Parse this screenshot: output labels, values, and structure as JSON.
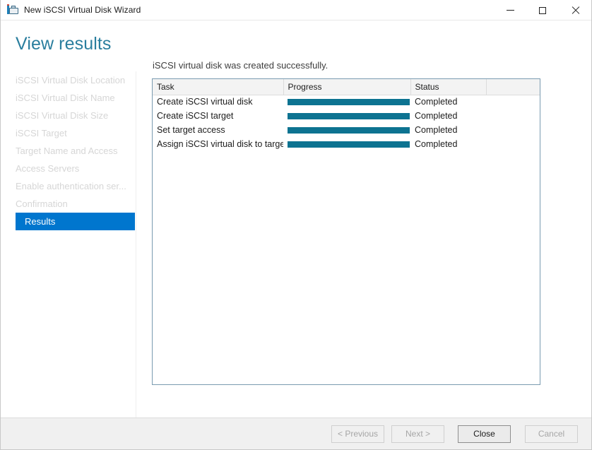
{
  "window": {
    "title": "New iSCSI Virtual Disk Wizard",
    "icon": "iscsi-disk-icon",
    "controls": {
      "minimize": "minimize-icon",
      "maximize": "maximize-icon",
      "close": "close-icon"
    }
  },
  "header": {
    "title": "View results",
    "title_color": "#2a7e9e"
  },
  "sidebar": {
    "items": [
      {
        "label": "iSCSI Virtual Disk Location",
        "active": false
      },
      {
        "label": "iSCSI Virtual Disk Name",
        "active": false
      },
      {
        "label": "iSCSI Virtual Disk Size",
        "active": false
      },
      {
        "label": "iSCSI Target",
        "active": false
      },
      {
        "label": "Target Name and Access",
        "active": false
      },
      {
        "label": "Access Servers",
        "active": false
      },
      {
        "label": "Enable authentication ser...",
        "active": false
      },
      {
        "label": "Confirmation",
        "active": false
      },
      {
        "label": "Results",
        "active": true
      }
    ],
    "active_bg": "#0076ce",
    "inactive_color": "#d6d6d6"
  },
  "main": {
    "success_message": "iSCSI virtual disk was created successfully.",
    "table": {
      "columns": [
        "Task",
        "Progress",
        "Status",
        ""
      ],
      "rows": [
        {
          "task": "Create iSCSI virtual disk",
          "progress": 100,
          "status": "Completed"
        },
        {
          "task": "Create iSCSI target",
          "progress": 100,
          "status": "Completed"
        },
        {
          "task": "Set target access",
          "progress": 100,
          "status": "Completed"
        },
        {
          "task": "Assign iSCSI virtual disk to target",
          "progress": 100,
          "status": "Completed"
        }
      ],
      "progress_color": "#0d7391"
    }
  },
  "footer": {
    "buttons": [
      {
        "label": "< Previous",
        "enabled": false
      },
      {
        "label": "Next >",
        "enabled": false
      },
      {
        "label": "Close",
        "enabled": true
      },
      {
        "label": "Cancel",
        "enabled": false
      }
    ]
  }
}
